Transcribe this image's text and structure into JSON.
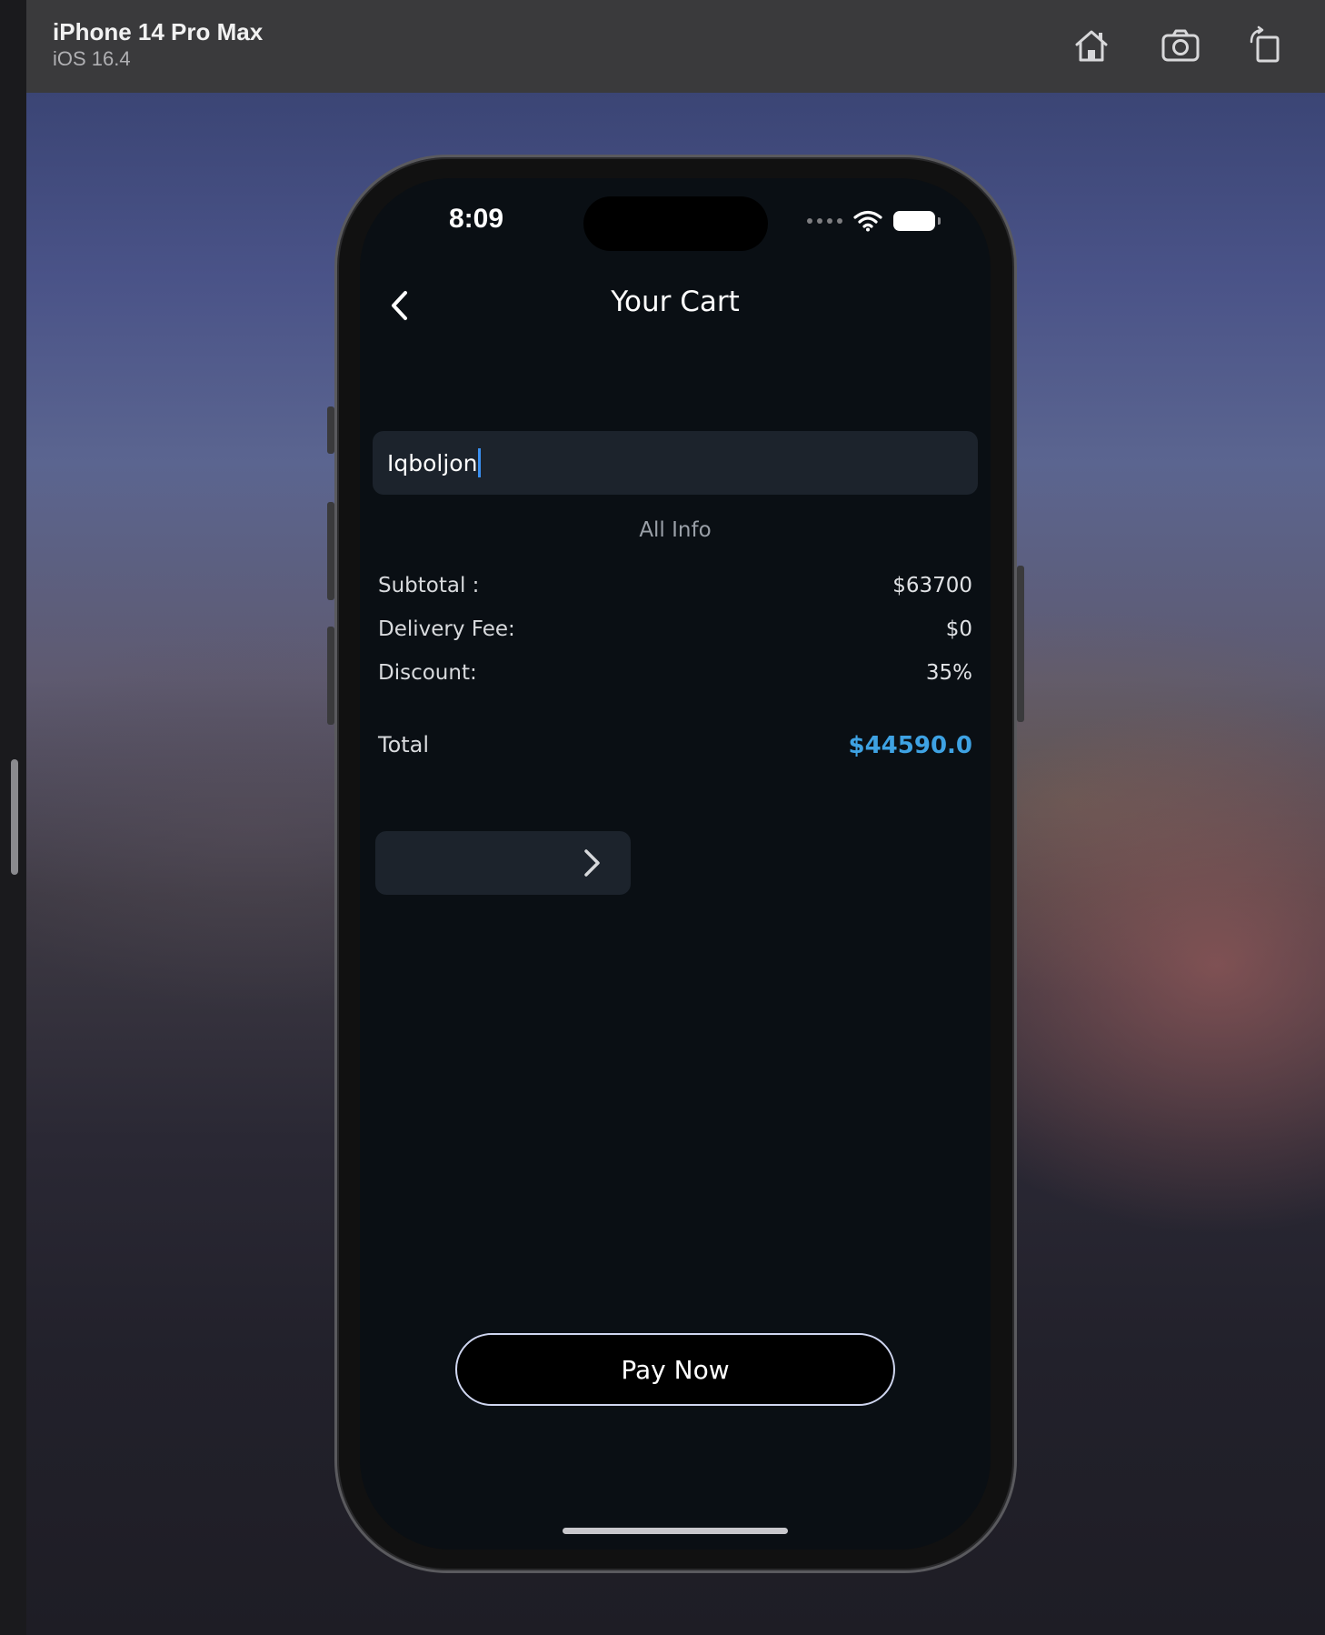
{
  "simulator": {
    "device_name": "iPhone 14 Pro Max",
    "os_version": "iOS 16.4",
    "toolbar_icons": [
      "home-icon",
      "camera-icon",
      "rotate-icon"
    ]
  },
  "status_bar": {
    "time": "8:09",
    "icons": [
      "cellular-dots-icon",
      "wifi-icon",
      "battery-icon"
    ]
  },
  "header": {
    "title": "Your Cart",
    "back_icon": "chevron-left-icon"
  },
  "name_input": {
    "value": "Iqboljon"
  },
  "summary": {
    "caption": "All Info",
    "rows": [
      {
        "label": "Subtotal :",
        "value": "$63700"
      },
      {
        "label": "Delivery Fee:",
        "value": "$0"
      },
      {
        "label": "Discount:",
        "value": "35%"
      }
    ],
    "total_label": "Total",
    "total_value": "$44590.0"
  },
  "next_button": {
    "icon": "chevron-right-icon"
  },
  "pay_button": {
    "label": "Pay Now"
  },
  "colors": {
    "accent": "#3ea2e3",
    "screen_bg": "#0a0f14",
    "field_bg": "#1c232c",
    "pay_border": "#cfd6f0"
  }
}
